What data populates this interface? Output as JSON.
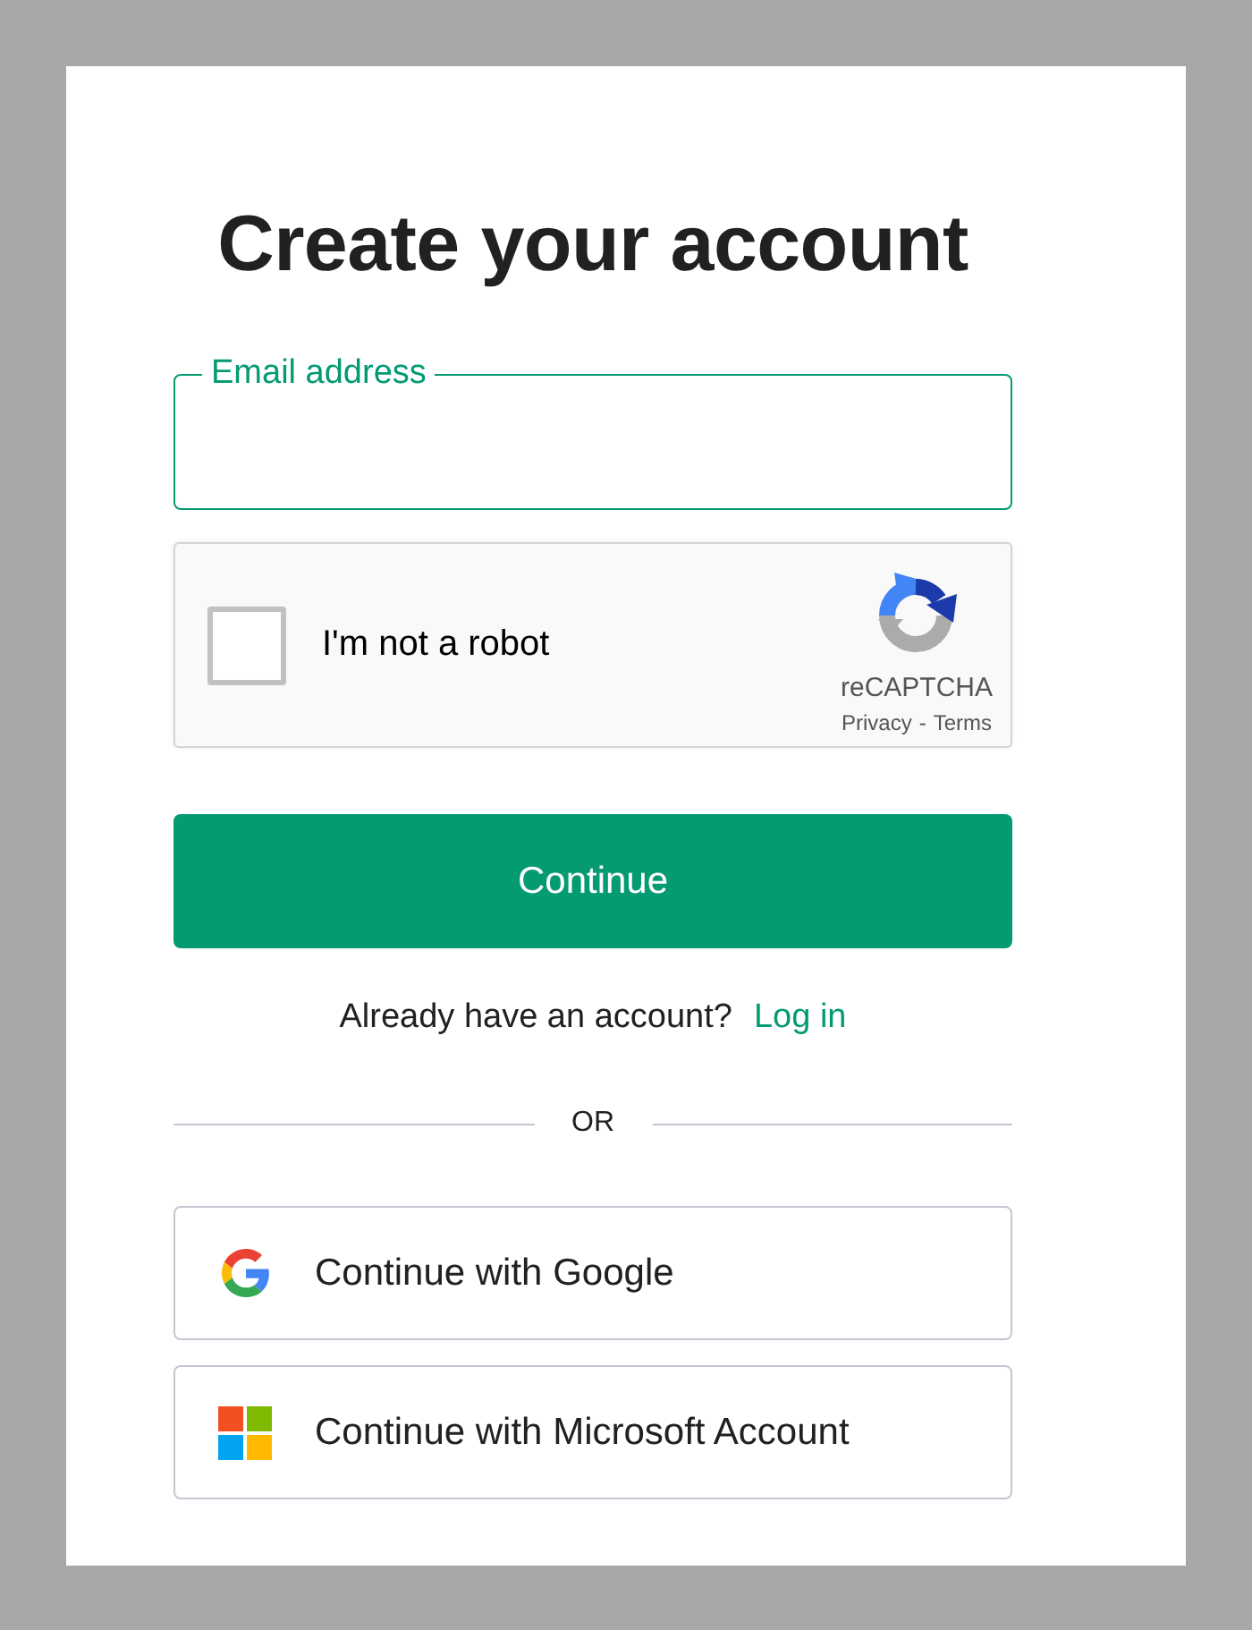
{
  "title": "Create your account",
  "email_field": {
    "label": "Email address",
    "focused": true
  },
  "captcha": {
    "label": "I'm not a robot",
    "checked": false,
    "brand": "reCAPTCHA",
    "links": [
      "Privacy",
      "Terms"
    ],
    "separator": "-"
  },
  "continue_button": "Continue",
  "login_prompt": {
    "text": "Already have an account?",
    "link": "Log in"
  },
  "divider": "OR",
  "social_buttons": [
    {
      "kind": "google",
      "label": "Continue with Google"
    },
    {
      "kind": "microsoft",
      "label": "Continue with Microsoft Account"
    }
  ]
}
